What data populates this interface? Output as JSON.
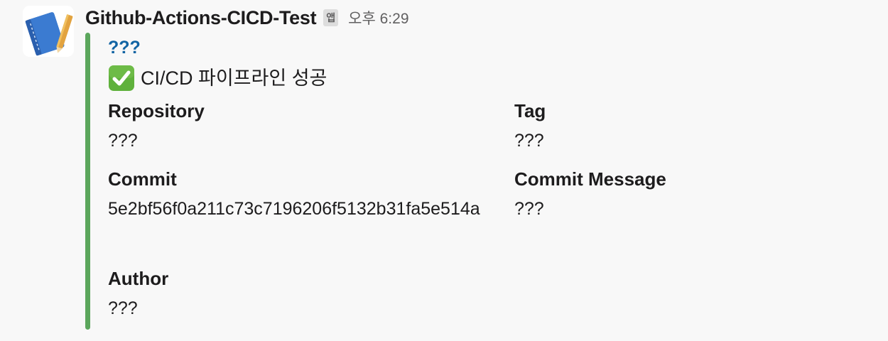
{
  "message": {
    "sender": "Github-Actions-CICD-Test",
    "app_badge": "앱",
    "timestamp": "오후 6:29",
    "avatar_icon": "notebook-icon"
  },
  "attachment": {
    "bar_color": "#5ba65c",
    "title": "???",
    "status_icon": "check-mark-button-icon",
    "text": "CI/CD 파이프라인 성공",
    "fields": {
      "repository": {
        "title": "Repository",
        "value": "???"
      },
      "tag": {
        "title": "Tag",
        "value": "???"
      },
      "commit": {
        "title": "Commit",
        "value": "5e2bf56f0a211c73c7196206f5132b31fa5e514a"
      },
      "commit_message": {
        "title": "Commit Message",
        "value": "???"
      },
      "author": {
        "title": "Author",
        "value": "???"
      }
    }
  }
}
